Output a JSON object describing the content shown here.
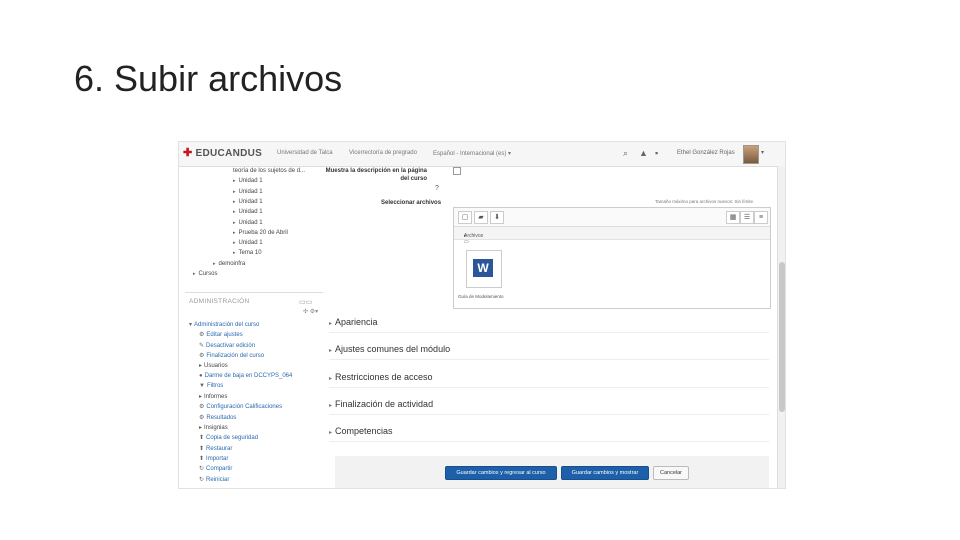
{
  "slide": {
    "title": "6. Subir archivos"
  },
  "topbar": {
    "brand": "EDUCANDUS",
    "nav": [
      "Universidad de Talca",
      "Vicerrectoría de pregrado",
      "Español - Internacional (es) ▾"
    ],
    "user": "Ethel González Rojas",
    "icons": [
      "search-icon",
      "bell-icon",
      "chat-icon"
    ]
  },
  "sidebar": {
    "tree": [
      {
        "label": "teoría de los sujetos de d...",
        "indent": 2,
        "tri": false
      },
      {
        "label": "Unidad 1",
        "indent": 2,
        "tri": true
      },
      {
        "label": "Unidad 1",
        "indent": 2,
        "tri": true
      },
      {
        "label": "Unidad 1",
        "indent": 2,
        "tri": true
      },
      {
        "label": "Unidad 1",
        "indent": 2,
        "tri": true
      },
      {
        "label": "Unidad 1",
        "indent": 2,
        "tri": true
      },
      {
        "label": "Prueba 20 de Abril",
        "indent": 2,
        "tri": true
      },
      {
        "label": "Unidad 1",
        "indent": 2,
        "tri": true
      },
      {
        "label": "Tema 10",
        "indent": 2,
        "tri": true
      },
      {
        "label": "demoinfra",
        "indent": 1,
        "tri": true
      },
      {
        "label": "Cursos",
        "indent": 0,
        "tri": true
      }
    ],
    "admin": {
      "title": "ADMINISTRACIÓN",
      "items": [
        {
          "label": "Administración del curso",
          "icon": "▾",
          "indent": 0,
          "style": "link"
        },
        {
          "label": "Editar ajustes",
          "icon": "⚙",
          "indent": 1,
          "style": "link"
        },
        {
          "label": "Desactivar edición",
          "icon": "✎",
          "indent": 1,
          "style": "link"
        },
        {
          "label": "Finalización del curso",
          "icon": "⚙",
          "indent": 1,
          "style": "link"
        },
        {
          "label": "Usuarios",
          "icon": "▸",
          "indent": 1,
          "style": "dark"
        },
        {
          "label": "Darme de baja en DCCYPS_064",
          "icon": "●",
          "indent": 1,
          "style": "link"
        },
        {
          "label": "Filtros",
          "icon": "▼",
          "indent": 1,
          "style": "link"
        },
        {
          "label": "Informes",
          "icon": "▸",
          "indent": 1,
          "style": "dark"
        },
        {
          "label": "Configuración Calificaciones",
          "icon": "⚙",
          "indent": 1,
          "style": "link"
        },
        {
          "label": "Resultados",
          "icon": "⚙",
          "indent": 1,
          "style": "link"
        },
        {
          "label": "Insignias",
          "icon": "▸",
          "indent": 1,
          "style": "dark"
        },
        {
          "label": "Copia de seguridad",
          "icon": "⬆",
          "indent": 1,
          "style": "link"
        },
        {
          "label": "Restaurar",
          "icon": "⬆",
          "indent": 1,
          "style": "link"
        },
        {
          "label": "Importar",
          "icon": "⬆",
          "indent": 1,
          "style": "link"
        },
        {
          "label": "Compartir",
          "icon": "↻",
          "indent": 1,
          "style": "link"
        },
        {
          "label": "Reiniciar",
          "icon": "↻",
          "indent": 1,
          "style": "link"
        }
      ]
    }
  },
  "main": {
    "desc_label": "Muestra la descripción en la página del curso",
    "files_label": "Seleccionar archivos",
    "picker_meta": "Tamaño máximo para archivos nuevos: Sin límite",
    "folder": "Archivos",
    "file_name": "Guía de Modelamiento",
    "sections": [
      "Apariencia",
      "Ajustes comunes del módulo",
      "Restricciones de acceso",
      "Finalización de actividad",
      "Competencias"
    ],
    "buttons": {
      "save_return": "Guardar cambios y regresar al curso",
      "save_show": "Guardar cambios y mostrar",
      "cancel": "Cancelar"
    }
  }
}
